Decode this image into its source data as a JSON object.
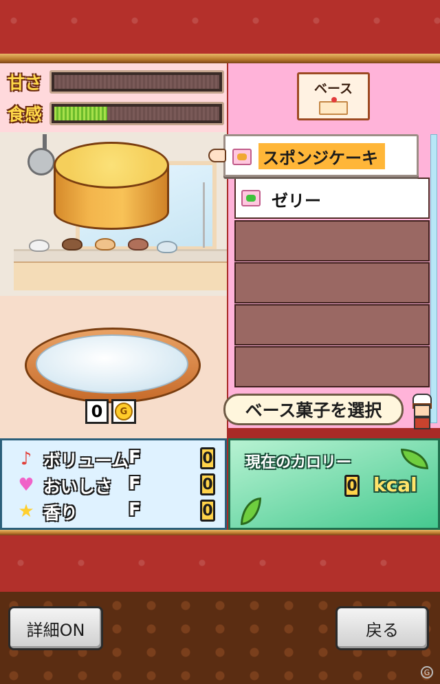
{
  "gauges": [
    {
      "label": "甘さ",
      "level": 0.0
    },
    {
      "label": "食感",
      "level": 0.32
    }
  ],
  "category_button": {
    "label": "ベース",
    "icon": "cake-icon"
  },
  "item_list": {
    "selected": {
      "label": "スポンジケーキ",
      "icon": "sponge-cake-icon"
    },
    "items": [
      {
        "label": "ゼリー",
        "icon": "jelly-icon"
      }
    ],
    "empty_rows": 4
  },
  "price": {
    "value": "0",
    "currency": "G"
  },
  "hint": {
    "text": "ベース菓子を選択"
  },
  "stats": [
    {
      "name": "ボリューム",
      "grade": "F",
      "value": "0",
      "icon": "music-note-icon",
      "color": "#e0403a"
    },
    {
      "name": "おいしさ",
      "grade": "F",
      "value": "0",
      "icon": "heart-icon",
      "color": "#f062c8"
    },
    {
      "name": "香り",
      "grade": "F",
      "value": "0",
      "icon": "star-icon",
      "color": "#ffcf2e"
    }
  ],
  "calorie": {
    "title": "現在のカロリー",
    "value": "0",
    "unit": "kcal"
  },
  "buttons": {
    "details": "詳細ON",
    "back": "戻る"
  },
  "colors": {
    "highlight": "#ffb638",
    "right_panel": "#ffb3d9",
    "gauge_fill": "#8fd445"
  }
}
